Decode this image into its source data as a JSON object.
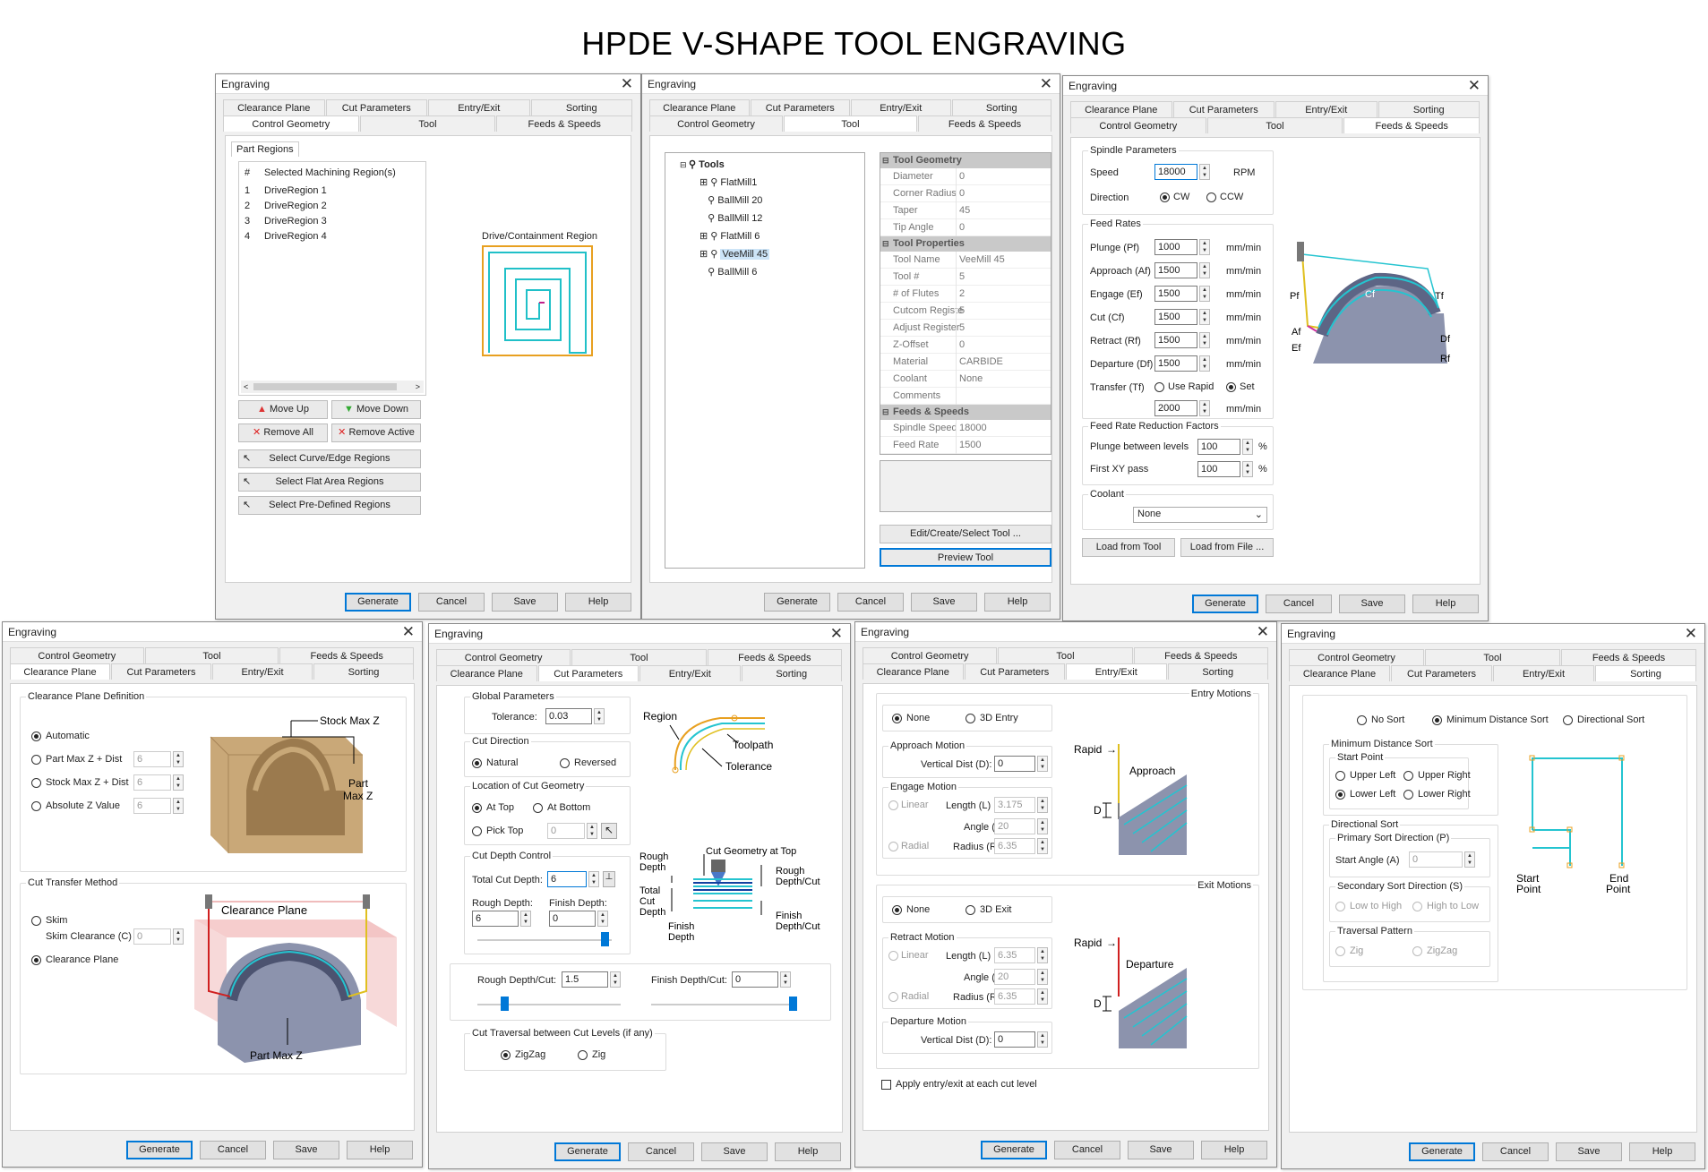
{
  "title": "HPDE V-SHAPE TOOL ENGRAVING",
  "dialog_title": "Engraving",
  "tabs": {
    "clearance": "Clearance Plane",
    "cut": "Cut Parameters",
    "entry": "Entry/Exit",
    "sorting": "Sorting",
    "control": "Control Geometry",
    "tool": "Tool",
    "feeds": "Feeds & Speeds"
  },
  "buttons": {
    "generate": "Generate",
    "cancel": "Cancel",
    "save": "Save",
    "help": "Help"
  },
  "d1": {
    "part_regions": "Part Regions",
    "col_num": "#",
    "col_name": "Selected Machining Region(s)",
    "regions": [
      {
        "n": "1",
        "name": "DriveRegion 1"
      },
      {
        "n": "2",
        "name": "DriveRegion 2"
      },
      {
        "n": "3",
        "name": "DriveRegion 3"
      },
      {
        "n": "4",
        "name": "DriveRegion 4"
      }
    ],
    "move_up": "Move Up",
    "move_down": "Move Down",
    "remove_all": "Remove All",
    "remove_active": "Remove Active",
    "sel_curve": "Select Curve/Edge Regions",
    "sel_flat": "Select Flat Area Regions",
    "sel_pre": "Select Pre-Defined Regions",
    "diagram_label": "Drive/Containment Region"
  },
  "d2": {
    "tools_root": "Tools",
    "tools": [
      "FlatMill1",
      "BallMill 20",
      "BallMill 12",
      "FlatMill 6",
      "VeeMill 45",
      "BallMill 6"
    ],
    "tool_geometry": "Tool Geometry",
    "geom": [
      [
        "Diameter",
        "0"
      ],
      [
        "Corner Radius",
        "0"
      ],
      [
        "Taper",
        "45"
      ],
      [
        "Tip Angle",
        "0"
      ]
    ],
    "tool_properties": "Tool Properties",
    "props": [
      [
        "Tool Name",
        "VeeMill 45"
      ],
      [
        "Tool #",
        "5"
      ],
      [
        "# of Flutes",
        "2"
      ],
      [
        "Cutcom Registe",
        "5"
      ],
      [
        "Adjust Register",
        "5"
      ],
      [
        "Z-Offset",
        "0"
      ],
      [
        "Material",
        "CARBIDE"
      ],
      [
        "Coolant",
        "None"
      ],
      [
        "Comments",
        ""
      ]
    ],
    "feeds_speeds": "Feeds & Speeds",
    "fs": [
      [
        "Spindle Speed",
        "18000"
      ],
      [
        "Feed Rate",
        "1500"
      ]
    ],
    "edit_btn": "Edit/Create/Select Tool ...",
    "preview_btn": "Preview Tool"
  },
  "d3": {
    "spindle": "Spindle Parameters",
    "speed_lbl": "Speed",
    "speed": "18000",
    "rpm": "RPM",
    "direction": "Direction",
    "cw": "CW",
    "ccw": "CCW",
    "feed_rates": "Feed Rates",
    "feeds": [
      [
        "Plunge (Pf)",
        "1000"
      ],
      [
        "Approach (Af)",
        "1500"
      ],
      [
        "Engage (Ef)",
        "1500"
      ],
      [
        "Cut (Cf)",
        "1500"
      ],
      [
        "Retract (Rf)",
        "1500"
      ],
      [
        "Departure (Df)",
        "1500"
      ]
    ],
    "unit": "mm/min",
    "transfer": "Transfer (Tf)",
    "use_rapid": "Use Rapid",
    "set": "Set",
    "transfer_val": "2000",
    "reduction": "Feed Rate Reduction Factors",
    "plunge_levels": "Plunge between levels",
    "plunge_val": "100",
    "first_xy": "First XY pass",
    "first_val": "100",
    "pct": "%",
    "coolant": "Coolant",
    "coolant_val": "None",
    "load_tool": "Load from Tool",
    "load_file": "Load from File ...",
    "diag": {
      "pf": "Pf",
      "af": "Af",
      "ef": "Ef",
      "cf": "Cf",
      "tf": "Tf",
      "df": "Df",
      "rf": "Rf"
    }
  },
  "d4": {
    "definition": "Clearance Plane Definition",
    "automatic": "Automatic",
    "partmax": "Part Max Z + Dist",
    "stockmax": "Stock Max Z + Dist",
    "absz": "Absolute Z Value",
    "v1": "6",
    "v2": "6",
    "v3": "6",
    "stock_max_z": "Stock Max Z",
    "part_max_z": "Part Max Z",
    "part": "Part",
    "max_z": "Max Z",
    "transfer": "Cut Transfer Method",
    "skim": "Skim",
    "skim_clear": "Skim Clearance (C)",
    "skim_val": "0",
    "clearance_plane": "Clearance Plane",
    "part_max_z_diag": "Part Max Z"
  },
  "d5": {
    "global": "Global Parameters",
    "tolerance": "Tolerance:",
    "tol_val": "0.03",
    "region": "Region",
    "toolpath": "Toolpath",
    "tol_label": "Tolerance",
    "cut_dir": "Cut Direction",
    "natural": "Natural",
    "reversed": "Reversed",
    "loc": "Location of Cut Geometry",
    "at_top": "At Top",
    "at_bottom": "At Bottom",
    "pick_top": "Pick Top",
    "pick_val": "0",
    "depth_ctrl": "Cut Depth Control",
    "total_depth": "Total Cut Depth:",
    "total_val": "6",
    "rough_depth": "Rough Depth:",
    "rough_val": "6",
    "finish_depth": "Finish Depth:",
    "finish_val": "0",
    "rough_per": "Rough Depth/Cut:",
    "rough_per_val": "1.5",
    "finish_per": "Finish Depth/Cut:",
    "finish_per_val": "0",
    "traversal": "Cut Traversal between Cut Levels (if any)",
    "zigzag": "ZigZag",
    "zig": "Zig",
    "diag": {
      "rough": "Rough",
      "depth": "Depth",
      "cgt": "Cut Geometry at Top",
      "rdc1": "Rough",
      "rdc2": "Depth/Cut",
      "total": "Total",
      "cut": "Cut",
      "depth2": "Depth",
      "finish": "Finish",
      "fdepth": "Depth",
      "fdc1": "Finish",
      "fdc2": "Depth/Cut"
    }
  },
  "d6": {
    "entry_motions": "Entry Motions",
    "exit_motions": "Exit Motions",
    "none": "None",
    "entry3d": "3D Entry",
    "exit3d": "3D Exit",
    "approach": "Approach Motion",
    "vdist": "Vertical Dist (D):",
    "vdist_val": "0",
    "engage": "Engage Motion",
    "linear": "Linear",
    "radial": "Radial",
    "length": "Length (L)",
    "angle": "Angle (A)",
    "radius": "Radius (R)",
    "eng_len": "3.175",
    "eng_ang": "20",
    "eng_rad": "6.35",
    "retract": "Retract Motion",
    "ret_len": "6.35",
    "ret_ang": "20",
    "ret_rad": "6.35",
    "departure": "Departure Motion",
    "dep_val": "0",
    "apply_each": "Apply entry/exit at each cut level",
    "rapid": "Rapid",
    "approach_lbl": "Approach",
    "departure_lbl": "Departure",
    "d": "D"
  },
  "d7": {
    "nosort": "No Sort",
    "mindist": "Minimum Distance Sort",
    "directional": "Directional Sort",
    "mds": "Minimum Distance Sort",
    "start_point": "Start Point",
    "ul": "Upper Left",
    "ur": "Upper Right",
    "ll": "Lower Left",
    "lr": "Lower Right",
    "dsort": "Directional Sort",
    "primary": "Primary Sort Direction (P)",
    "start_angle": "Start Angle (A)",
    "angle_val": "0",
    "secondary": "Secondary Sort Direction (S)",
    "lth": "Low to High",
    "htl": "High to Low",
    "traversal": "Traversal Pattern",
    "zig": "Zig",
    "zigzag": "ZigZag",
    "start": "Start",
    "point": "Point",
    "end": "End",
    "point2": "Point"
  }
}
